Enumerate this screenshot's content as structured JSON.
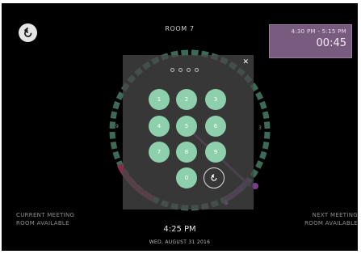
{
  "header": {
    "room_title": "ROOM 7"
  },
  "current_booking": {
    "time_range": "4:30 PM - 5:15 PM",
    "remaining": "00:45"
  },
  "keypad": {
    "keys": [
      "1",
      "2",
      "3",
      "4",
      "5",
      "6",
      "7",
      "8",
      "9",
      "0"
    ],
    "pin_length": 4
  },
  "dial": {
    "left_label": "9",
    "right_label": "3"
  },
  "footer": {
    "current_meeting_label": "CURRENT MEETING",
    "current_meeting_status": "ROOM AVAILABLE",
    "next_meeting_label": "NEXT MEETING",
    "next_meeting_status": "ROOM AVAILABLE",
    "time": "4:25 PM",
    "date": "WED, AUGUST 31 2016"
  },
  "colors": {
    "background": "#000000",
    "key_green": "#8ed0ad",
    "ring_green": "#3c6a56",
    "booking_purple": "#7a5b80",
    "booking_pink": "#8a2c4a"
  },
  "icons": {
    "back": "back-arrow-icon",
    "close": "close-icon",
    "undo": "undo-icon"
  }
}
